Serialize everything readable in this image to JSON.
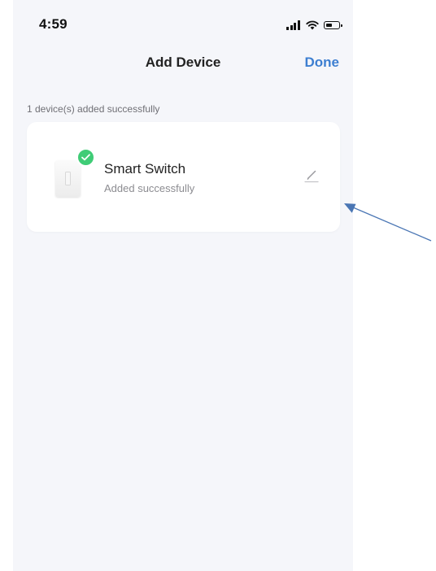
{
  "status_bar": {
    "time": "4:59",
    "icons": [
      "cellular-signal-icon",
      "wifi-icon",
      "battery-icon"
    ]
  },
  "nav": {
    "title": "Add Device",
    "done_label": "Done"
  },
  "summary": {
    "text": "1 device(s) added successfully"
  },
  "devices": [
    {
      "name": "Smart Switch",
      "status": "Added successfully",
      "icons": [
        "smart-switch-thumbnail",
        "check-icon",
        "edit-pencil-icon"
      ]
    }
  ],
  "colors": {
    "accent": "#3d7fd1",
    "success": "#3fcc76",
    "background": "#f5f6fa",
    "card": "#ffffff",
    "annotation_arrow": "#4a76b4"
  }
}
